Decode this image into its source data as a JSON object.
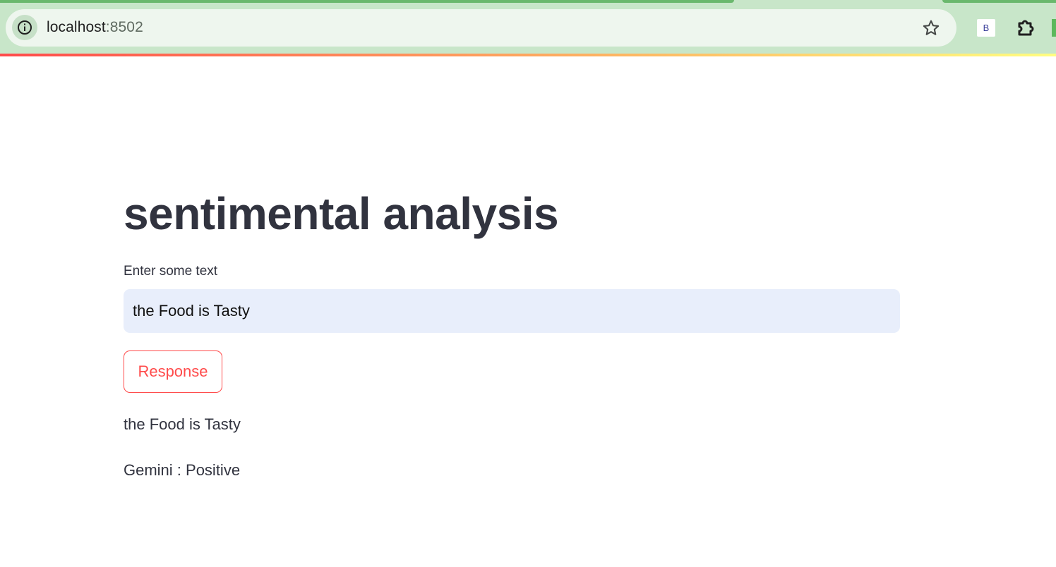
{
  "browser": {
    "url_host": "localhost",
    "url_port": ":8502",
    "extension_badge": "B"
  },
  "app": {
    "title": "sentimental analysis",
    "input_label": "Enter some text",
    "input_value": "the Food is Tasty",
    "button_label": "Response",
    "echo_text": "the Food is Tasty",
    "result_text": "Gemini : Positive"
  },
  "colors": {
    "accent": "#ff4b4b",
    "text": "#31333f",
    "input_bg": "#e8eefb",
    "chrome_bg": "#c8e6c9"
  }
}
